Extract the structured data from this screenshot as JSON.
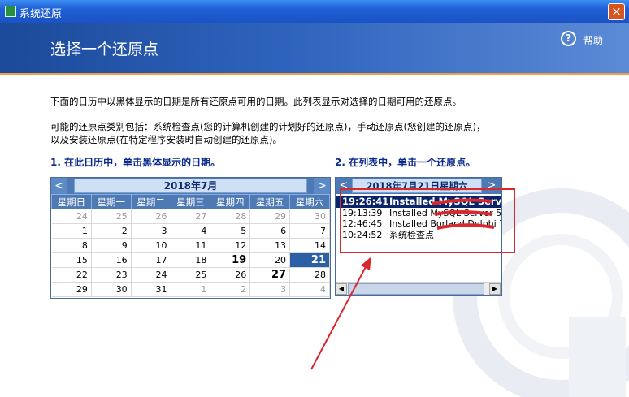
{
  "window": {
    "title": "系统还原",
    "close_label": "×"
  },
  "header": {
    "page_title": "选择一个还原点",
    "help_label": "帮助",
    "help_glyph": "?"
  },
  "description": {
    "line1": "下面的日历中以黑体显示的日期是所有还原点可用的日期。此列表显示对选择的日期可用的还原点。",
    "line2": "可能的还原点类别包括：系统检查点(您的计算机创建的计划好的还原点)，手动还原点(您创建的还原点)，",
    "line3": "以及安装还原点(在特定程序安装时自动创建的还原点)。"
  },
  "step1": {
    "title": "1. 在此日历中，单击黑体显示的日期。"
  },
  "step2": {
    "title": "2. 在列表中，单击一个还原点。"
  },
  "calendar": {
    "month_label": "2018年7月",
    "prev": "<",
    "next": ">",
    "weekdays": [
      "星期日",
      "星期一",
      "星期二",
      "星期三",
      "星期四",
      "星期五",
      "星期六"
    ],
    "weeks": [
      [
        "24",
        "25",
        "26",
        "27",
        "28",
        "29",
        "30"
      ],
      [
        "1",
        "2",
        "3",
        "4",
        "5",
        "6",
        "7"
      ],
      [
        "8",
        "9",
        "10",
        "11",
        "12",
        "13",
        "14"
      ],
      [
        "15",
        "16",
        "17",
        "18",
        "19",
        "20",
        "21"
      ],
      [
        "22",
        "23",
        "24",
        "25",
        "26",
        "27",
        "28"
      ],
      [
        "29",
        "30",
        "31",
        "1",
        "2",
        "3",
        "4"
      ]
    ],
    "bold_days": [
      "19",
      "27"
    ],
    "selected_day": "21"
  },
  "restore_list": {
    "date_label": "2018年7月21日星期六",
    "prev": "<",
    "next": ">",
    "items": [
      {
        "time": "19:26:41",
        "desc": "Installed MySQL Serv",
        "selected": true
      },
      {
        "time": "19:13:39",
        "desc": "Installed MySQL Server 5"
      },
      {
        "time": "12:46:45",
        "desc": "Installed Borland Delphi 7"
      },
      {
        "time": "10:24:52",
        "desc": "系统检查点"
      }
    ],
    "scroll_left": "◀",
    "scroll_right": "▶"
  },
  "colors": {
    "annotation": "#d9272e",
    "header": "#2e63bd",
    "selection": "#0a246a"
  }
}
